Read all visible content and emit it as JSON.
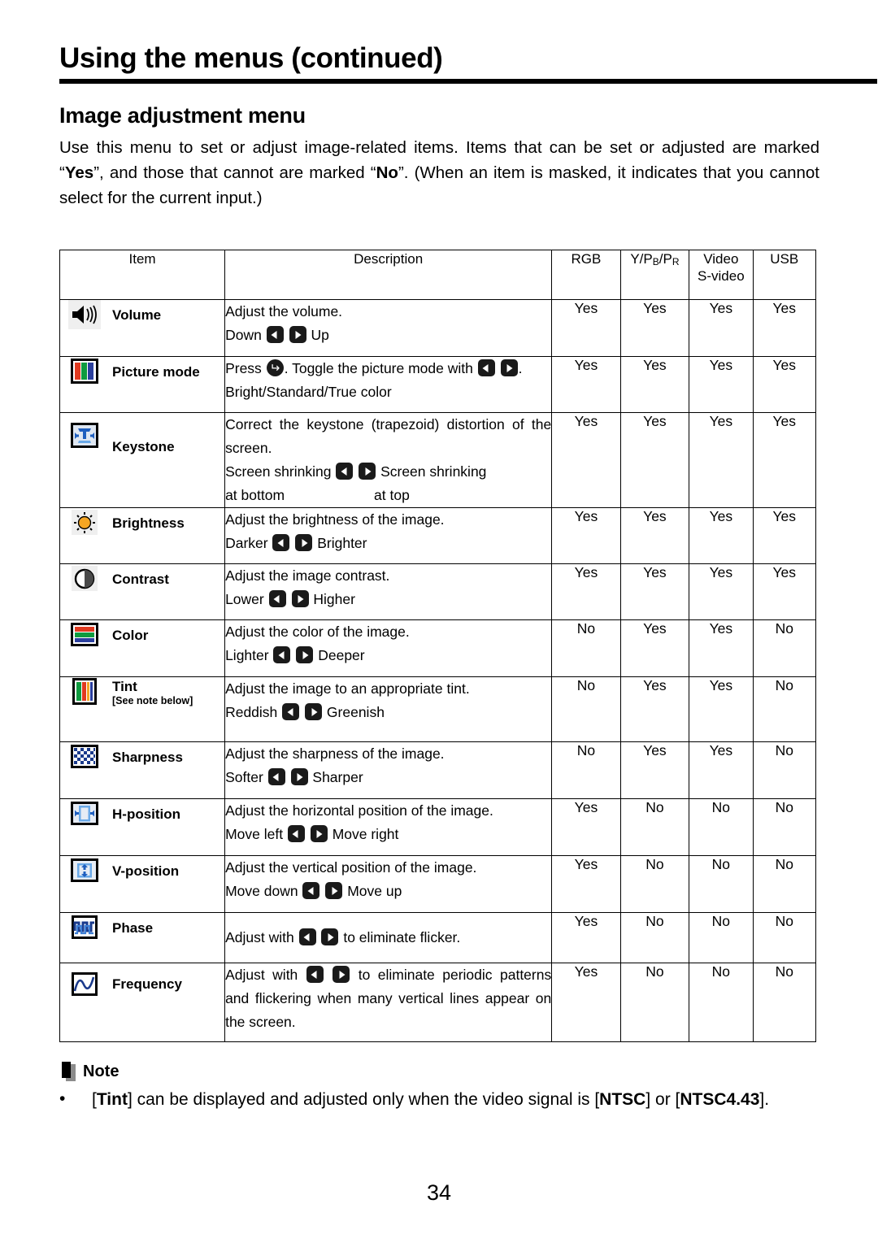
{
  "header": {
    "chapter_title": "Using the menus (continued)",
    "section_title": "Image adjustment menu",
    "intro_part1": "Use this menu to set or adjust image-related items. Items that can be set or adjusted are marked “",
    "intro_yes": "Yes",
    "intro_part2": "”, and those that cannot are marked “",
    "intro_no": "No",
    "intro_part3": "”. (When an item is masked, it indicates that you cannot select for the current input.)"
  },
  "table": {
    "headers": {
      "item": "Item",
      "description": "Description",
      "rgb": "RGB",
      "ypbpr_y": "Y/P",
      "ypbpr_b": "B",
      "ypbpr_slash": "/P",
      "ypbpr_r": "R",
      "video_line1": "Video",
      "video_line2": "S-video",
      "usb": "USB"
    },
    "rows": [
      {
        "icon": "speaker-icon",
        "label": "Volume",
        "sublabel": "",
        "desc_line1": "Adjust the volume.",
        "desc_pre": "Down",
        "desc_post": "Up",
        "rgb": "Yes",
        "ypbpr": "Yes",
        "video": "Yes",
        "usb": "Yes"
      },
      {
        "icon": "picture-mode-icon",
        "label": "Picture mode",
        "sublabel": "",
        "desc_press_pre": "Press",
        "desc_press_mid": ". Toggle the picture mode with",
        "desc_press_post": ".",
        "desc_line2": "Bright/Standard/True color",
        "rgb": "Yes",
        "ypbpr": "Yes",
        "video": "Yes",
        "usb": "Yes"
      },
      {
        "icon": "keystone-icon",
        "label": "Keystone",
        "sublabel": "",
        "desc_line1": "Correct the keystone (trapezoid) distortion of the screen.",
        "desc_pre": "Screen shrinking",
        "desc_post": "Screen shrinking",
        "desc_sub_left": "at bottom",
        "desc_sub_right": "at top",
        "rgb": "Yes",
        "ypbpr": "Yes",
        "video": "Yes",
        "usb": "Yes"
      },
      {
        "icon": "brightness-icon",
        "label": "Brightness",
        "sublabel": "",
        "desc_line1": "Adjust the brightness of the image.",
        "desc_pre": "Darker",
        "desc_post": "Brighter",
        "rgb": "Yes",
        "ypbpr": "Yes",
        "video": "Yes",
        "usb": "Yes"
      },
      {
        "icon": "contrast-icon",
        "label": "Contrast",
        "sublabel": "",
        "desc_line1": "Adjust the image contrast.",
        "desc_pre": "Lower",
        "desc_post": "Higher",
        "rgb": "Yes",
        "ypbpr": "Yes",
        "video": "Yes",
        "usb": "Yes"
      },
      {
        "icon": "color-icon",
        "label": "Color",
        "sublabel": "",
        "desc_line1": "Adjust the color of the image.",
        "desc_pre": "Lighter",
        "desc_post": "Deeper",
        "rgb": "No",
        "ypbpr": "Yes",
        "video": "Yes",
        "usb": "No"
      },
      {
        "icon": "tint-icon",
        "label": "Tint",
        "sublabel": "[See note below]",
        "desc_line1": "Adjust the image to an appropriate tint.",
        "desc_pre": "Reddish",
        "desc_post": "Greenish",
        "rgb": "No",
        "ypbpr": "Yes",
        "video": "Yes",
        "usb": "No"
      },
      {
        "icon": "sharpness-icon",
        "label": "Sharpness",
        "sublabel": "",
        "desc_line1": "Adjust the sharpness of the image.",
        "desc_pre": "Softer",
        "desc_post": "Sharper",
        "rgb": "No",
        "ypbpr": "Yes",
        "video": "Yes",
        "usb": "No"
      },
      {
        "icon": "h-position-icon",
        "label": "H-position",
        "sublabel": "",
        "desc_line1": "Adjust the horizontal position of the image.",
        "desc_pre": "Move left",
        "desc_post": "Move right",
        "rgb": "Yes",
        "ypbpr": "No",
        "video": "No",
        "usb": "No"
      },
      {
        "icon": "v-position-icon",
        "label": "V-position",
        "sublabel": "",
        "desc_line1": "Adjust the vertical position of the image.",
        "desc_pre": "Move down",
        "desc_post": "Move up",
        "rgb": "Yes",
        "ypbpr": "No",
        "video": "No",
        "usb": "No"
      },
      {
        "icon": "phase-icon",
        "label": "Phase",
        "sublabel": "",
        "desc_pre": "Adjust with",
        "desc_post": "to eliminate flicker.",
        "rgb": "Yes",
        "ypbpr": "No",
        "video": "No",
        "usb": "No"
      },
      {
        "icon": "frequency-icon",
        "label": "Frequency",
        "sublabel": "",
        "desc_pre": "Adjust with",
        "desc_post": "to eliminate periodic patterns and flickering when many vertical lines appear on the screen.",
        "rgb": "Yes",
        "ypbpr": "No",
        "video": "No",
        "usb": "No"
      }
    ]
  },
  "note": {
    "icon": "note-icon",
    "title": "Note",
    "bullet": "•",
    "body_pre": "[",
    "body_tint": "Tint",
    "body_mid": "] can be displayed and adjusted only when the video signal is [",
    "body_ntsc": "NTSC",
    "body_mid2": "] or [",
    "body_ntsc443": "NTSC4.43",
    "body_post": "]."
  },
  "footer": {
    "page_number": "34"
  },
  "colors": {
    "red": "#e03a20",
    "green": "#0f9b3f",
    "blue": "#2b3f9e",
    "orange": "#f5a623",
    "icon_blue": "#1f5fbf",
    "icon_light_blue": "#6aa9e8",
    "note_gray": "#8c8c8c"
  }
}
